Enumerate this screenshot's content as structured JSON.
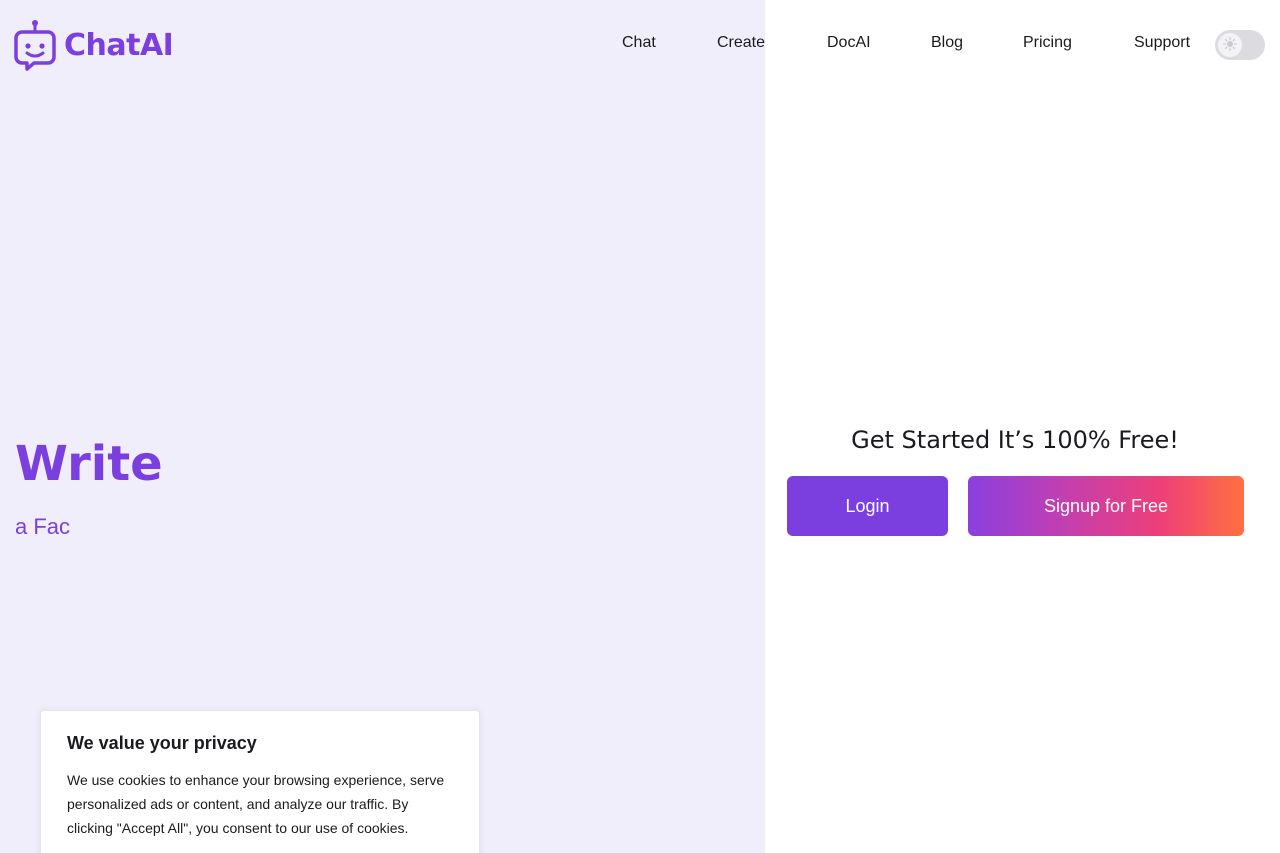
{
  "brand": {
    "name": "ChatAI",
    "color": "#7b3fe0",
    "icon": "robot-icon"
  },
  "nav": {
    "items": [
      "Chat",
      "Create",
      "DocAI",
      "Blog",
      "Pricing",
      "Support"
    ]
  },
  "theme_toggle": {
    "icon": "sun-icon",
    "state": "light"
  },
  "hero": {
    "title": "Write",
    "subtitle": "a Fac"
  },
  "cta": {
    "heading": "Get Started It’s 100% Free!",
    "login_label": "Login",
    "signup_label": "Signup for Free"
  },
  "cookie_banner": {
    "title": "We value your privacy",
    "text": "We use cookies to enhance your browsing experience, serve personalized ads or content, and analyze our traffic. By clicking \"Accept All\", you consent to our use of cookies."
  },
  "colors": {
    "left_panel_bg": "#f0eefb",
    "accent": "#7b3fe0"
  }
}
